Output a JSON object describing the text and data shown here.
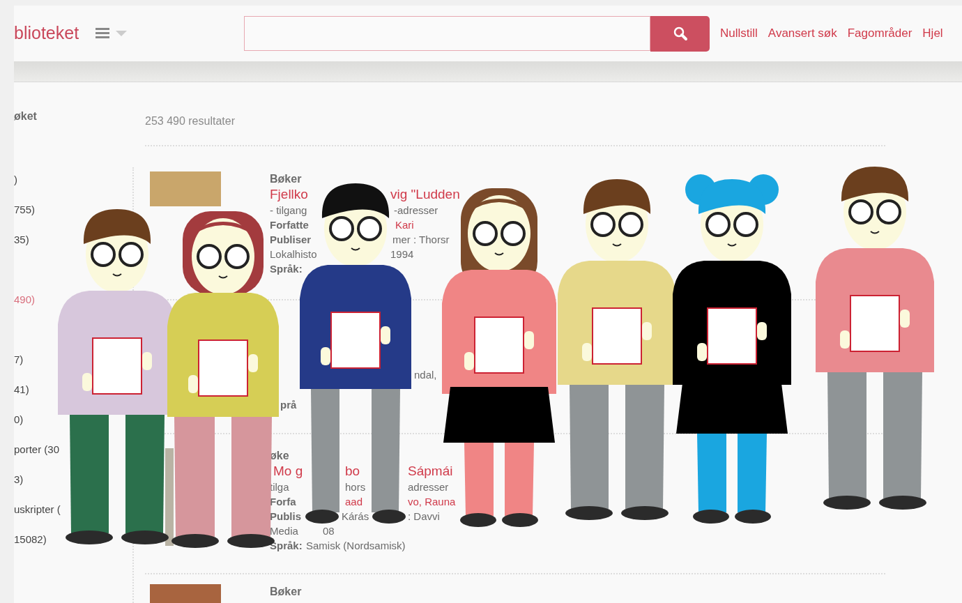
{
  "header": {
    "logo": "blioteket",
    "links": [
      "Nullstill",
      "Avansert søk",
      "Fagområder",
      "Hjel"
    ]
  },
  "sidebar": {
    "heading": "øket",
    "items": [
      {
        "text": ")",
        "selected": false
      },
      {
        "text": "755)",
        "selected": false
      },
      {
        "text": "35)",
        "selected": false
      },
      {
        "text": "490)",
        "selected": true
      },
      {
        "text": "7)",
        "selected": false
      },
      {
        "text": "41)",
        "selected": false
      },
      {
        "text": "0)",
        "selected": false
      },
      {
        "text": "porter (30",
        "selected": false
      },
      {
        "text": "3)",
        "selected": false
      },
      {
        "text": "uskripter (",
        "selected": false
      },
      {
        "text": "15082)",
        "selected": false
      }
    ]
  },
  "results": {
    "count": "253 490 resultater",
    "items": [
      {
        "type": "Bøker",
        "title": [
          "Fjellko",
          "vig \"Ludden"
        ],
        "lines": [
          [
            {
              "text": "- tilgang",
              "kind": "plain"
            },
            {
              "text": "-adresser",
              "kind": "plain"
            }
          ],
          [
            {
              "text": "Forfatte",
              "kind": "label"
            },
            {
              "text": "Kari",
              "kind": "link"
            }
          ],
          [
            {
              "text": "Publiser",
              "kind": "label"
            },
            {
              "text": "mer : Thorsr",
              "kind": "plain"
            }
          ],
          [
            {
              "text": "Lokalhisto",
              "kind": "plain"
            },
            {
              "text": "1994",
              "kind": "plain"
            }
          ],
          [
            {
              "text": "Språk:",
              "kind": "label"
            }
          ]
        ]
      },
      {
        "lines": [
          [
            {
              "text": "ndal,",
              "kind": "plain"
            }
          ],
          [
            {
              "text": "prå",
              "kind": "label"
            }
          ]
        ]
      },
      {
        "type": "øke",
        "title": [
          "Mo g",
          "bo",
          "Sápmái"
        ],
        "lines": [
          [
            {
              "text": "tilga",
              "kind": "plain"
            },
            {
              "text": "hors",
              "kind": "plain"
            },
            {
              "text": "adresser",
              "kind": "plain"
            }
          ],
          [
            {
              "text": "Forfa",
              "kind": "label"
            },
            {
              "text": "aad",
              "kind": "link"
            },
            {
              "text": "vo, Rauna",
              "kind": "link"
            }
          ],
          [
            {
              "text": "Publis",
              "kind": "label"
            },
            {
              "text": "Kárás",
              "kind": "plain"
            },
            {
              "text": ": Davvi",
              "kind": "plain"
            }
          ],
          [
            {
              "text": "Media",
              "kind": "plain"
            },
            {
              "text": "08",
              "kind": "plain"
            }
          ],
          [
            {
              "text": "Språk:",
              "kind": "label"
            },
            {
              "text": "Samisk (Nordsamisk)",
              "kind": "plain"
            }
          ]
        ]
      },
      {
        "type": "Bøker"
      }
    ]
  }
}
